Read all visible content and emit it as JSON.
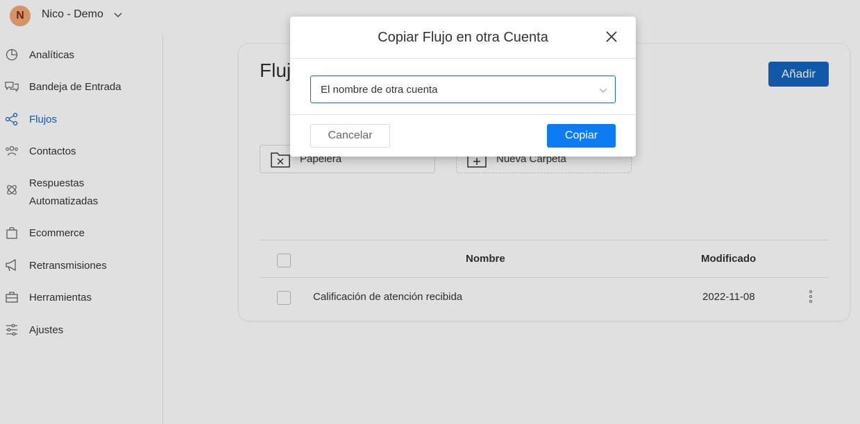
{
  "account": {
    "initial": "N",
    "name": "Nico - Demo"
  },
  "sidebar": {
    "items": [
      {
        "label": "Analíticas",
        "icon": "pie-chart-icon"
      },
      {
        "label": "Bandeja de Entrada",
        "icon": "chat-bubbles-icon"
      },
      {
        "label": "Flujos",
        "icon": "flow-nodes-icon",
        "active": true
      },
      {
        "label": "Contactos",
        "icon": "people-icon"
      },
      {
        "label": "Respuestas Automatizadas",
        "icon": "atom-icon"
      },
      {
        "label": "Ecommerce",
        "icon": "shopping-bag-icon"
      },
      {
        "label": "Retransmisiones",
        "icon": "megaphone-icon"
      },
      {
        "label": "Herramientas",
        "icon": "toolbox-icon"
      },
      {
        "label": "Ajustes",
        "icon": "sliders-icon"
      }
    ]
  },
  "main": {
    "title": "Fluj",
    "add_label": "Añadir",
    "folders": [
      {
        "label": "Papelera",
        "icon": "trash-folder-icon"
      },
      {
        "label": "Nueva Carpeta",
        "icon": "new-folder-icon"
      }
    ],
    "table": {
      "headers": {
        "name": "Nombre",
        "modified": "Modificado"
      },
      "rows": [
        {
          "name": "Calificación de atención recibida",
          "modified": "2022-11-08"
        }
      ]
    }
  },
  "modal": {
    "title": "Copiar Flujo en otra Cuenta",
    "select_value": "El nombre de otra cuenta",
    "cancel_label": "Cancelar",
    "copy_label": "Copiar"
  },
  "colors": {
    "primary": "#1565c0",
    "copy_button": "#0d7cf2",
    "avatar": "#f2a878"
  }
}
